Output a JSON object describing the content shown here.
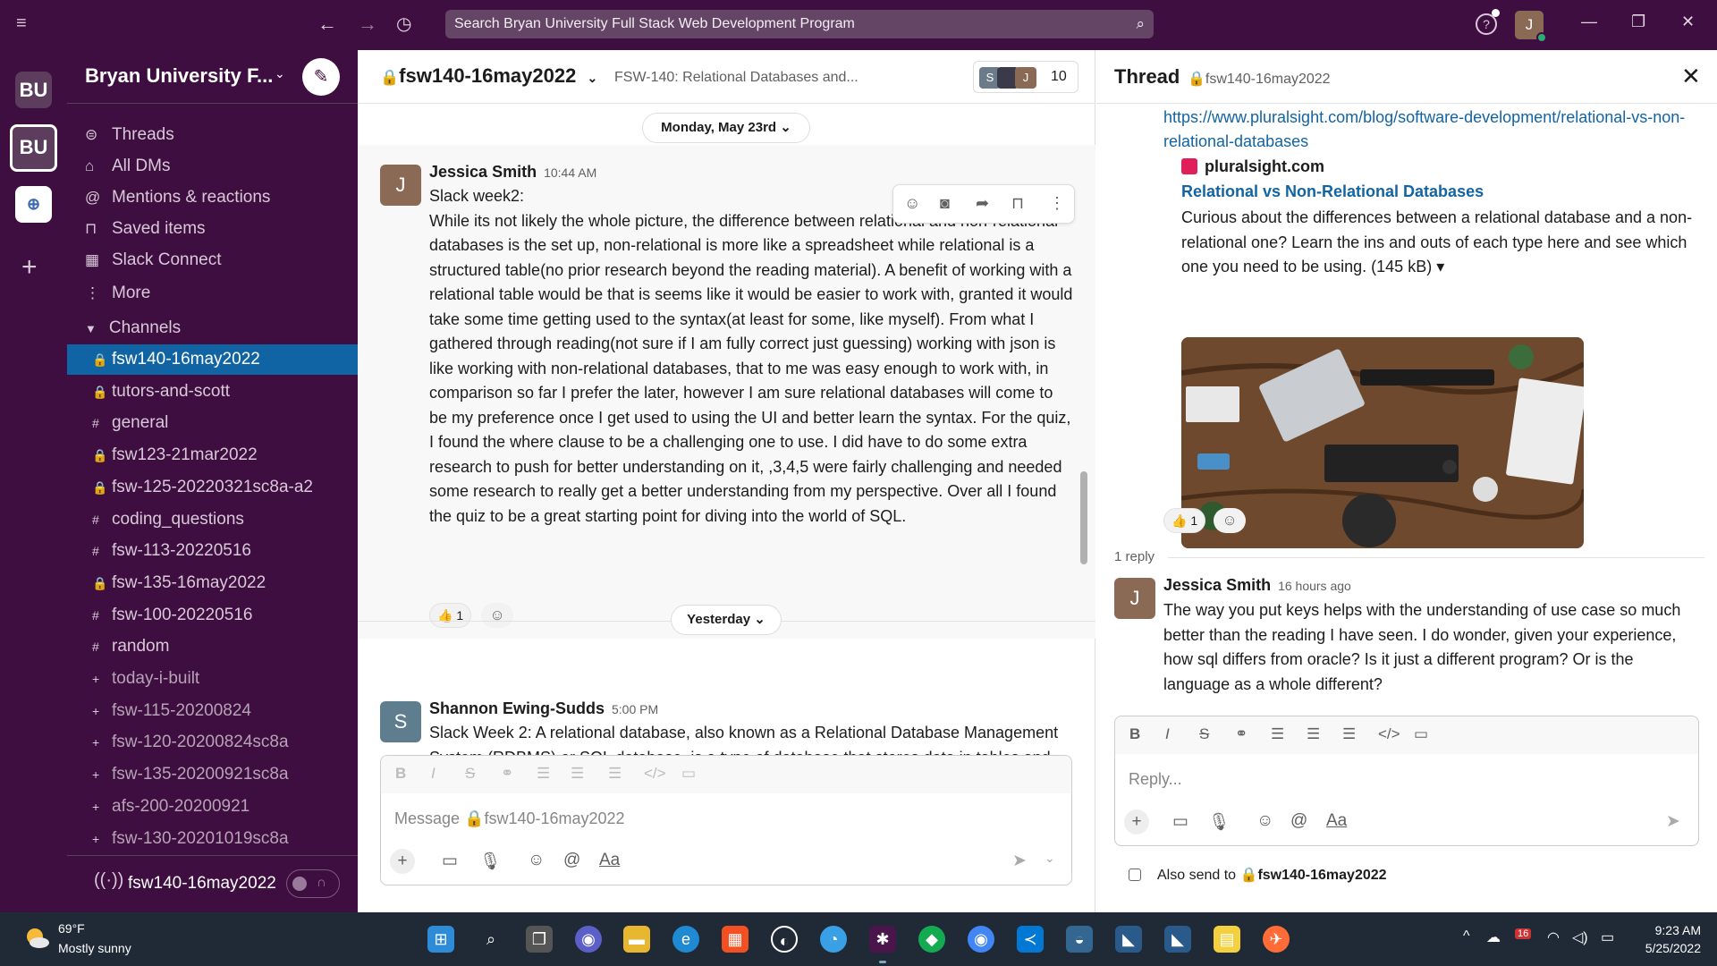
{
  "topbar": {
    "search_placeholder": "Search Bryan University Full Stack Web Development Program",
    "user_initial": "J"
  },
  "workspaces": [
    {
      "label": "BU"
    },
    {
      "label": "BU"
    },
    {
      "label": "⊕"
    }
  ],
  "sidebar": {
    "workspace_name": "Bryan University F...",
    "nav": [
      {
        "label": "Threads",
        "icon": "threads-icon"
      },
      {
        "label": "All DMs",
        "icon": "dms-icon"
      },
      {
        "label": "Mentions & reactions",
        "icon": "mention-icon"
      },
      {
        "label": "Saved items",
        "icon": "bookmark-icon"
      },
      {
        "label": "Slack Connect",
        "icon": "building-icon"
      },
      {
        "label": "More",
        "icon": "more-icon"
      }
    ],
    "channels_header": "Channels",
    "channels": [
      {
        "prefix": "🔒",
        "name": "fsw140-16may2022",
        "selected": true,
        "muted": false
      },
      {
        "prefix": "🔒",
        "name": "tutors-and-scott",
        "selected": false,
        "muted": false
      },
      {
        "prefix": "#",
        "name": "general",
        "selected": false,
        "muted": false
      },
      {
        "prefix": "🔒",
        "name": "fsw123-21mar2022",
        "selected": false,
        "muted": false
      },
      {
        "prefix": "🔒",
        "name": "fsw-125-20220321sc8a-a2",
        "selected": false,
        "muted": false
      },
      {
        "prefix": "#",
        "name": "coding_questions",
        "selected": false,
        "muted": false
      },
      {
        "prefix": "#",
        "name": "fsw-113-20220516",
        "selected": false,
        "muted": false
      },
      {
        "prefix": "🔒",
        "name": "fsw-135-16may2022",
        "selected": false,
        "muted": false
      },
      {
        "prefix": "#",
        "name": "fsw-100-20220516",
        "selected": false,
        "muted": false
      },
      {
        "prefix": "#",
        "name": "random",
        "selected": false,
        "muted": false
      },
      {
        "prefix": "+",
        "name": "today-i-built",
        "selected": false,
        "muted": true
      },
      {
        "prefix": "+",
        "name": "fsw-115-20200824",
        "selected": false,
        "muted": true
      },
      {
        "prefix": "+",
        "name": "fsw-120-20200824sc8a",
        "selected": false,
        "muted": true
      },
      {
        "prefix": "+",
        "name": "fsw-135-20200921sc8a",
        "selected": false,
        "muted": true
      },
      {
        "prefix": "+",
        "name": "afs-200-20200921",
        "selected": false,
        "muted": true
      },
      {
        "prefix": "+",
        "name": "fsw-130-20201019sc8a",
        "selected": false,
        "muted": true
      }
    ],
    "huddle_channel": "fsw140-16may2022"
  },
  "channel": {
    "name": "fsw140-16may2022",
    "topic": "FSW-140: Relational Databases and...",
    "member_count": "10",
    "member_initials": [
      "S",
      "",
      "J"
    ],
    "date_divider_1": "Monday, May 23rd",
    "date_divider_2": "Yesterday",
    "messages": [
      {
        "initial": "J",
        "author": "Jessica Smith",
        "time": "10:44 AM",
        "text": "Slack week2:\nWhile its not likely the whole picture, the difference between relational and non-relational databases is the set up, non-relational is more like a spreadsheet while relational is a structured table(no prior research beyond the reading material). A benefit of working with a relational table would be that is seems like it would be easier to work with, granted it would take some time getting used to the syntax(at least for some, like myself). From what I gathered through reading(not sure if I am fully correct just guessing) working with json is like working with non-relational databases, that to me was easy enough to work with, in comparison so far I prefer the later, however I am sure relational databases will come to be my preference once I get used to using the UI and better learn the syntax. For the quiz, I found the where clause to be a challenging one to use. I did have to do some extra research to push for better understanding on it, ,3,4,5 were fairly challenging and needed some research to really get a better understanding from my  perspective. Over all I found the quiz to be a great starting point for diving into the world of SQL.",
        "reaction_emoji": "👍",
        "reaction_count": "1"
      },
      {
        "initial": "S",
        "author": "Shannon Ewing-Sudds",
        "time": "5:00 PM",
        "text": "Slack Week 2: A relational database, also known as a Relational Database Management System (RDBMS) or SQL database, is a type of database that stores data in tables and rows, also known as records. There are no tables, rows, primary keys, or foreign keys,"
      }
    ],
    "composer_placeholder": "Message 🔒fsw140-16may2022"
  },
  "thread": {
    "title": "Thread",
    "channel": "🔒fsw140-16may2022",
    "link": "https://www.pluralsight.com/blog/software-development/relational-vs-non-relational-databases",
    "unfurl_site": "pluralsight.com",
    "unfurl_title": "Relational vs Non-Relational Databases",
    "unfurl_desc": "Curious about the differences between a relational database and a non-relational one? Learn the ins and outs of each type here and see which one you need to be using. (145 kB) ▾",
    "reaction_emoji": "👍",
    "reaction_count": "1",
    "reply_count": "1 reply",
    "reply": {
      "initial": "J",
      "author": "Jessica Smith",
      "time": "16 hours ago",
      "text": "The way you put keys helps with the understanding of use case so much better than the reading I have seen. I do wonder, given your experience, how sql differs from oracle? Is it just a different program?  Or is the language as a whole different?"
    },
    "composer_placeholder": "Reply...",
    "also_send_label": "Also send to",
    "also_send_channel": "🔒fsw140-16may2022"
  },
  "taskbar": {
    "temp": "69°F",
    "weather": "Mostly sunny",
    "time": "9:23 AM",
    "date": "5/25/2022",
    "notif_badge": "16"
  },
  "colors": {
    "aubergine": "#3f0e40",
    "selected": "#1164a3",
    "link": "#1264a3",
    "avatar_j": "#8a6a55",
    "avatar_s": "#5e7d8e"
  }
}
